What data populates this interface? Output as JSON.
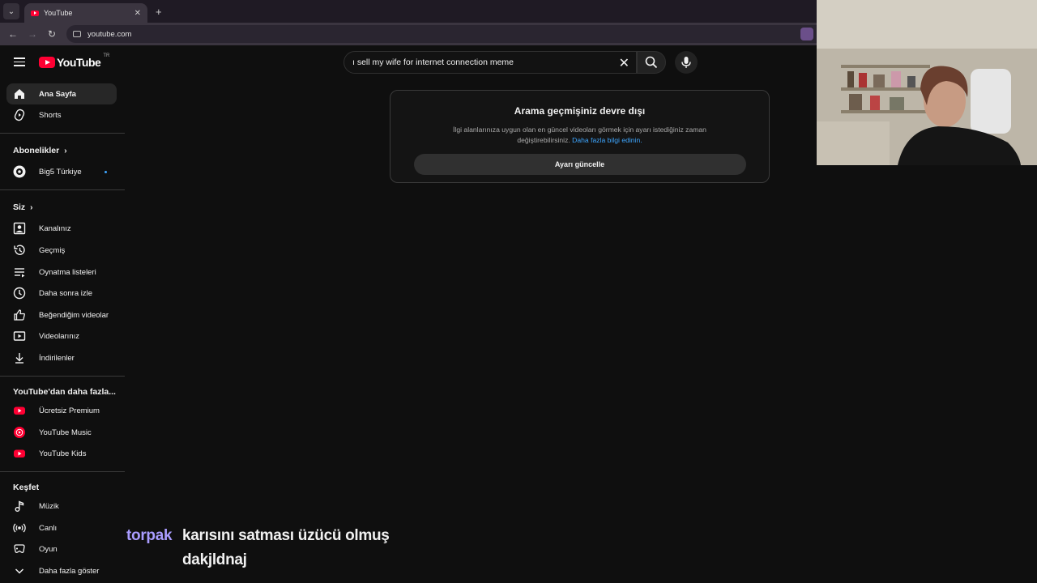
{
  "browser": {
    "tab_title": "YouTube",
    "tab_close": "✕",
    "new_tab": "+",
    "url": "youtube.com"
  },
  "header": {
    "logo_text": "YouTube",
    "country_code": "TR",
    "search_value": "ı sell my wife for internet connection meme",
    "clear_icon": "✕"
  },
  "sidebar": {
    "top_items": [
      {
        "label": "Ana Sayfa",
        "icon": "home-icon",
        "active": true
      },
      {
        "label": "Shorts",
        "icon": "shorts-icon"
      }
    ],
    "subscriptions_heading": "Abonelikler",
    "subscriptions": [
      {
        "label": "Big5 Türkiye",
        "icon": "channel-avatar",
        "new_dot": true
      }
    ],
    "you_heading": "Siz",
    "you_items": [
      {
        "label": "Kanalınız",
        "icon": "account-box-icon"
      },
      {
        "label": "Geçmiş",
        "icon": "history-icon"
      },
      {
        "label": "Oynatma listeleri",
        "icon": "playlist-icon"
      },
      {
        "label": "Daha sonra izle",
        "icon": "clock-icon"
      },
      {
        "label": "Beğendiğim videolar",
        "icon": "thumbs-up-icon"
      },
      {
        "label": "Videolarınız",
        "icon": "video-icon"
      },
      {
        "label": "İndirilenler",
        "icon": "download-icon"
      }
    ],
    "more_heading": "YouTube'dan daha fazla...",
    "more_items": [
      {
        "label": "Ücretsiz Premium",
        "icon": "youtube-premium-icon"
      },
      {
        "label": "YouTube Music",
        "icon": "youtube-music-icon"
      },
      {
        "label": "YouTube Kids",
        "icon": "youtube-kids-icon"
      }
    ],
    "explore_heading": "Keşfet",
    "explore_items": [
      {
        "label": "Müzik",
        "icon": "music-note-icon"
      },
      {
        "label": "Canlı",
        "icon": "live-icon"
      },
      {
        "label": "Oyun",
        "icon": "gaming-icon"
      },
      {
        "label": "Daha fazla göster",
        "icon": "chevron-down-icon"
      }
    ]
  },
  "notice": {
    "title": "Arama geçmişiniz devre dışı",
    "body": "İlgi alanlarınıza uygun olan en güncel videoları görmek için ayarı istediğiniz zaman değiştirebilirsiniz.",
    "link": "Daha fazla bilgi edinin.",
    "button": "Ayarı güncelle"
  },
  "chat": {
    "username": "torpak",
    "line1": "karısını satması üzücü olmuş",
    "line2": "dakjldnaj"
  },
  "colors": {
    "accent_red": "#ff0033",
    "link_blue": "#3ea6ff",
    "chat_name": "#a99cff"
  }
}
